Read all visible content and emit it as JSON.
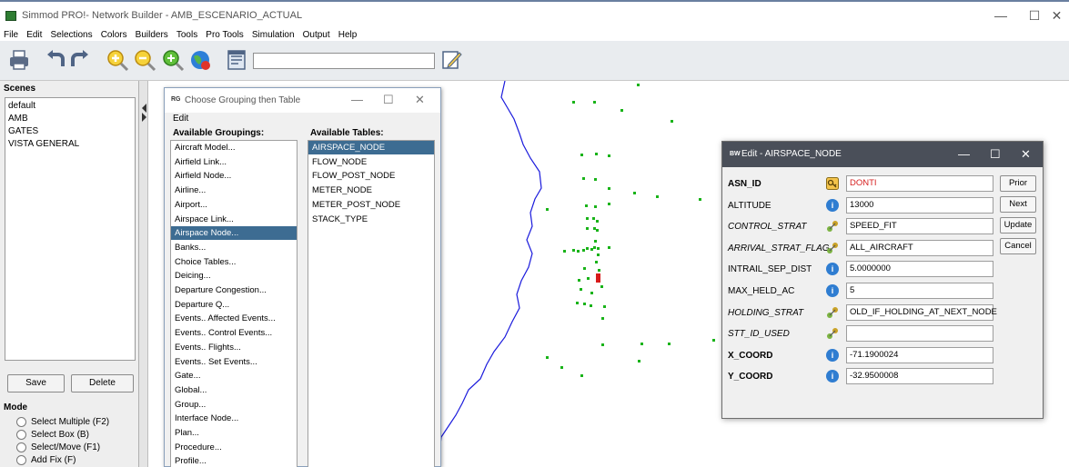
{
  "app": {
    "title": "Simmod PRO!- Network Builder - AMB_ESCENARIO_ACTUAL",
    "controls": {
      "minimize": "—",
      "maximize": "☐",
      "close": "✕"
    }
  },
  "menu": [
    "File",
    "Edit",
    "Selections",
    "Colors",
    "Builders",
    "Tools",
    "Pro Tools",
    "Simulation",
    "Output",
    "Help"
  ],
  "toolbar": {
    "icons": [
      "print-icon",
      "undo-icon",
      "redo-icon",
      "zoom-in-icon",
      "zoom-out-icon",
      "zoom-fit-icon",
      "globe-icon",
      "notepad-icon",
      "edit-pencil-icon"
    ],
    "input_value": ""
  },
  "scenes": {
    "header": "Scenes",
    "items": [
      "default",
      "AMB",
      "GATES",
      "VISTA GENERAL"
    ],
    "save_label": "Save",
    "delete_label": "Delete"
  },
  "mode": {
    "header": "Mode",
    "options": [
      "Select Multiple (F2)",
      "Select Box (B)",
      "Select/Move (F1)",
      "Add Fix (F)"
    ]
  },
  "grouping_window": {
    "icon_text": "RG",
    "title": "Choose Grouping then Table",
    "menu_edit": "Edit",
    "groupings_header": "Available Groupings:",
    "tables_header": "Available Tables:",
    "groupings": [
      "Aircraft Model...",
      "Airfield Link...",
      "Airfield Node...",
      "Airline...",
      "Airport...",
      "Airspace Link...",
      "Airspace Node...",
      "Banks...",
      "Choice Tables...",
      "Deicing...",
      "Departure Congestion...",
      "Departure Q...",
      "Events.. Affected Events...",
      "Events.. Control Events...",
      "Events.. Flights...",
      "Events.. Set Events...",
      "Gate...",
      "Global...",
      "Group...",
      "Interface Node...",
      "Plan...",
      "Procedure...",
      "Profile..."
    ],
    "groupings_selected": 6,
    "tables": [
      "AIRSPACE_NODE",
      "FLOW_NODE",
      "FLOW_POST_NODE",
      "METER_NODE",
      "METER_POST_NODE",
      "STACK_TYPE"
    ],
    "tables_selected": 0
  },
  "edit_window": {
    "icon_text": "BW",
    "title": "Edit - AIRSPACE_NODE",
    "fields": [
      {
        "label": "ASN_ID",
        "value": "DONTI",
        "icon": "key-icon"
      },
      {
        "label": "ALTITUDE",
        "value": "13000",
        "icon": "info-icon"
      },
      {
        "label": "CONTROL_STRAT",
        "value": "SPEED_FIT",
        "icon": "link-icon"
      },
      {
        "label": "ARRIVAL_STRAT_FLAG",
        "value": "ALL_AIRCRAFT",
        "icon": "link-icon"
      },
      {
        "label": "INTRAIL_SEP_DIST",
        "value": "5.0000000",
        "icon": "info-icon"
      },
      {
        "label": "MAX_HELD_AC",
        "value": "5",
        "icon": "info-icon"
      },
      {
        "label": "HOLDING_STRAT",
        "value": "OLD_IF_HOLDING_AT_NEXT_NODE",
        "icon": "link-icon"
      },
      {
        "label": "STT_ID_USED",
        "value": "",
        "icon": "link-icon"
      },
      {
        "label": "X_COORD",
        "value": "-71.1900024",
        "icon": "info-icon"
      },
      {
        "label": "Y_COORD",
        "value": "-32.9500008",
        "icon": "info-icon"
      }
    ],
    "info_glyph": "i",
    "buttons": {
      "prior": "Prior",
      "next": "Next",
      "update": "Update",
      "cancel": "Cancel"
    }
  },
  "colors": {
    "selection": "#3d6c92",
    "edit_titlebar": "#4a4f59",
    "map_nodes": "#19b319",
    "boundary": "#1a1adc",
    "selected_node": "#d81b1b",
    "error_text": "#d62020"
  }
}
